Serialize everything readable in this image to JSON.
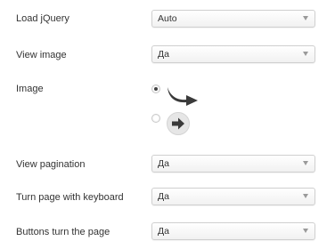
{
  "settings": {
    "load_jquery": {
      "label": "Load jQuery",
      "value": "Auto"
    },
    "view_image": {
      "label": "View image",
      "value": "Да"
    },
    "image": {
      "label": "Image",
      "options": [
        {
          "icon": "curved-arrow-icon",
          "checked": true
        },
        {
          "icon": "circle-arrow-icon",
          "checked": false
        }
      ]
    },
    "view_pagination": {
      "label": "View pagination",
      "value": "Да"
    },
    "turn_page_keyboard": {
      "label": "Turn page with keyboard",
      "value": "Да"
    },
    "buttons_turn_page": {
      "label": "Buttons turn the page",
      "value": "Да"
    }
  },
  "colors": {
    "text": "#333333",
    "select_border": "#cfcfcf",
    "icon_dark": "#3a3a3a",
    "icon_light_bg": "#e6e6e6"
  }
}
